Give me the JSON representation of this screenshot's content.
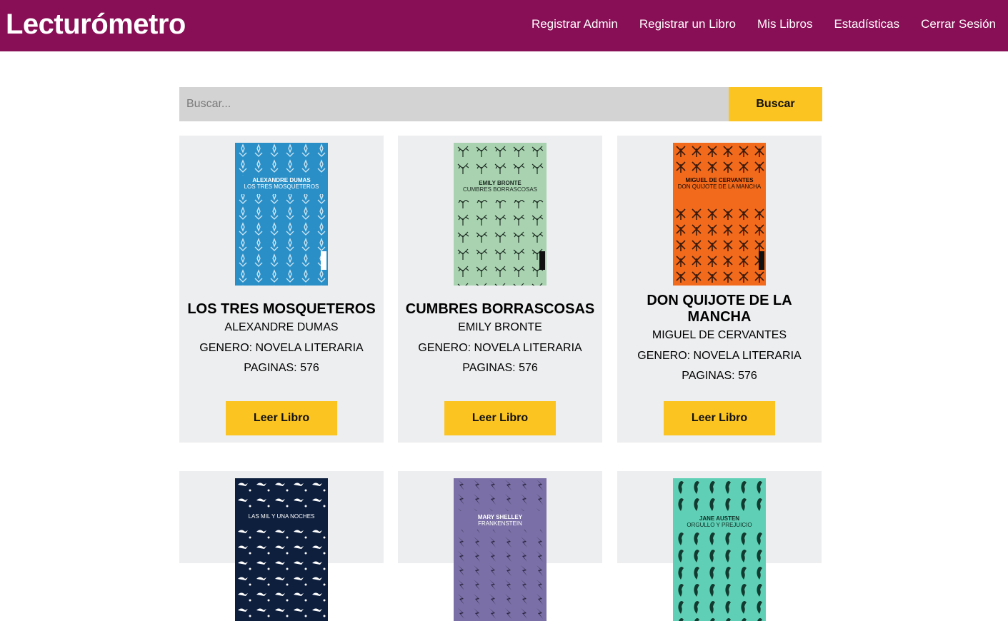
{
  "app": {
    "title": "Lecturómetro"
  },
  "nav": {
    "items": [
      {
        "label": "Registrar Admin"
      },
      {
        "label": "Registrar un Libro"
      },
      {
        "label": "Mis Libros"
      },
      {
        "label": "Estadísticas"
      },
      {
        "label": "Cerrar Sesión"
      }
    ]
  },
  "search": {
    "placeholder": "Buscar...",
    "value": "",
    "button_label": "Buscar"
  },
  "books": [
    {
      "title": "LOS TRES MOSQUETEROS",
      "author": "ALEXANDRE DUMAS",
      "genre": "GENERO: NOVELA LITERARIA",
      "pages": "PAGINAS: 576",
      "button_label": "Leer Libro",
      "cover": {
        "color": "#2b8fc7",
        "author": "ALEXANDRE DUMAS",
        "title": "LOS TRES MOSQUETEROS",
        "badge": "AUSTRAL"
      }
    },
    {
      "title": "CUMBRES BORRASCOSAS",
      "author": "EMILY BRONTE",
      "genre": "GENERO: NOVELA LITERARIA",
      "pages": "PAGINAS: 576",
      "button_label": "Leer Libro",
      "cover": {
        "color": "#a9d3b0",
        "author": "EMILY BRONTË",
        "title": "CUMBRES BORRASCOSAS",
        "badge": "AUSTRAL"
      }
    },
    {
      "title": "DON QUIJOTE DE LA MANCHA",
      "author": "MIGUEL DE CERVANTES",
      "genre": "GENERO: NOVELA LITERARIA",
      "pages": "PAGINAS: 576",
      "button_label": "Leer Libro",
      "cover": {
        "color": "#f26a1b",
        "author": "MIGUEL DE CERVANTES",
        "title": "DON QUIJOTE DE LA MANCHA",
        "badge": "AUSTRAL"
      }
    },
    {
      "cover": {
        "color": "#0e1f3d",
        "author": "",
        "title": "LAS MIL Y UNA NOCHES"
      }
    },
    {
      "cover": {
        "color": "#7a6fa6",
        "author": "MARY SHELLEY",
        "title": "FRANKENSTEIN"
      }
    },
    {
      "cover": {
        "color": "#5fd0b5",
        "author": "JANE AUSTEN",
        "title": "ORGULLO Y PREJUICIO"
      }
    }
  ],
  "colors": {
    "header": "#880e55",
    "accent": "#fbc421",
    "card": "#edeef0",
    "search_bg": "#d3d3d3"
  }
}
